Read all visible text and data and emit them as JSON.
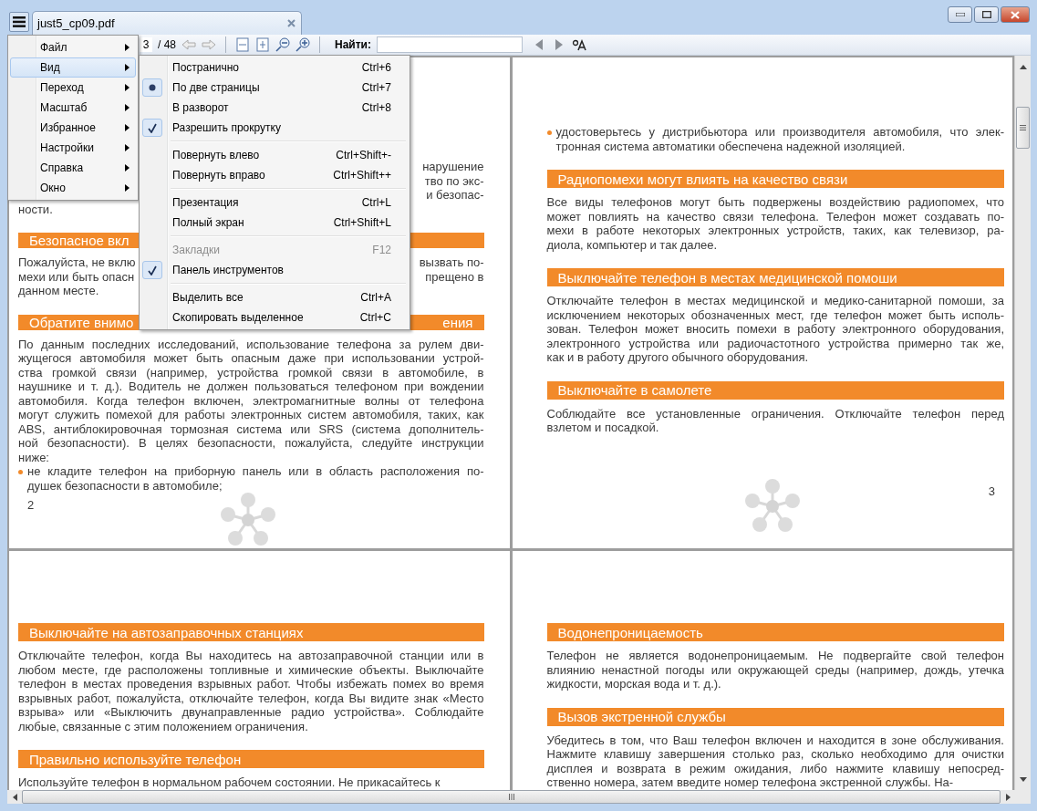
{
  "window": {
    "tab_title": "just5_cp09.pdf"
  },
  "main_menu": [
    {
      "label": "Файл",
      "selected": false
    },
    {
      "label": "Вид",
      "selected": true
    },
    {
      "label": "Переход",
      "selected": false
    },
    {
      "label": "Масштаб",
      "selected": false
    },
    {
      "label": "Избранное",
      "selected": false
    },
    {
      "label": "Настройки",
      "selected": false
    },
    {
      "label": "Справка",
      "selected": false
    },
    {
      "label": "Окно",
      "selected": false
    }
  ],
  "submenu": {
    "groups": [
      [
        {
          "label": "Постранично",
          "shortcut": "Ctrl+6",
          "kind": "radio",
          "checked": false,
          "disabled": false
        },
        {
          "label": "По две страницы",
          "shortcut": "Ctrl+7",
          "kind": "radio",
          "checked": true,
          "disabled": false
        },
        {
          "label": "В разворот",
          "shortcut": "Ctrl+8",
          "kind": "radio",
          "checked": false,
          "disabled": false
        },
        {
          "label": "Разрешить прокрутку",
          "kind": "check",
          "checked": true,
          "disabled": false
        }
      ],
      [
        {
          "label": "Повернуть влево",
          "shortcut": "Ctrl+Shift+-",
          "kind": "check",
          "checked": false,
          "disabled": false
        },
        {
          "label": "Повернуть вправо",
          "shortcut": "Ctrl+Shift++",
          "kind": "check",
          "checked": false,
          "disabled": false
        }
      ],
      [
        {
          "label": "Презентация",
          "shortcut": "Ctrl+L",
          "kind": "check",
          "checked": false,
          "disabled": false
        },
        {
          "label": "Полный экран",
          "shortcut": "Ctrl+Shift+L",
          "kind": "check",
          "checked": false,
          "disabled": false
        }
      ],
      [
        {
          "label": "Закладки",
          "shortcut": "F12",
          "kind": "check",
          "checked": false,
          "disabled": true
        },
        {
          "label": "Панель инструментов",
          "kind": "check",
          "checked": true,
          "disabled": false
        }
      ],
      [
        {
          "label": "Выделить все",
          "shortcut": "Ctrl+A",
          "kind": "check",
          "checked": false,
          "disabled": false
        },
        {
          "label": "Скопировать выделенное",
          "shortcut": "Ctrl+C",
          "kind": "check",
          "checked": false,
          "disabled": false
        }
      ]
    ]
  },
  "toolbar": {
    "page": "3",
    "page_total": "/ 48",
    "find_label": "Найти:"
  },
  "page_rows": [
    [
      {
        "number": "2",
        "blocks": [
          {
            "kind": "fragments",
            "lines": [
              {
                "right": "нарушение"
              },
              {
                "right": "тво по экс-"
              },
              {
                "right": "и безопас-"
              },
              {
                "left": "ности."
              }
            ]
          },
          {
            "kind": "heading_fragments",
            "left": "Безопасное вкл"
          },
          {
            "kind": "fragments",
            "lines": [
              {
                "left": "Пожалуйста, не вклю",
                "right": "вызвать по-"
              },
              {
                "left": "мехи или быть опасн",
                "right": "прещено в"
              },
              {
                "left": "данном месте."
              }
            ]
          },
          {
            "kind": "heading_fragments",
            "left": "Обратите внимо",
            "right": "ения"
          },
          {
            "kind": "paragraph",
            "lines": [
              "По данным последних исследований, использование телефона за рулем дви-",
              "жущегося автомобиля может быть опасным даже при использовании устрой-",
              "ства громкой связи (например, устройства громкой связи в автомобиле, в",
              "наушнике и т. д.). Водитель не должен пользоваться телефоном при вождении",
              "автомобиля. Когда телефон включен, электромагнитные волны от телефона",
              "могут служить помехой для работы электронных систем автомобиля, таких, как",
              "ABS, антиблокировочная тормозная система или SRS (система дополнитель-",
              "ной безопасности). В целях безопасности, пожалуйста, следуйте инструкции",
              "ниже:"
            ]
          },
          {
            "kind": "bullet",
            "lines": [
              "не кладите телефон на приборную панель или в область расположения по-",
              "душек безопасности в автомобиле;"
            ]
          }
        ]
      },
      {
        "number": "3",
        "blocks": [
          {
            "kind": "bullet",
            "lines": [
              "удостоверьтесь у дистрибьютора или производителя автомобиля, что элек-",
              "тронная система автоматики обеспечена надежной изоляцией."
            ]
          },
          {
            "kind": "heading",
            "text": "Радиопомехи могут влиять на качество связи"
          },
          {
            "kind": "paragraph",
            "lines": [
              "Все виды телефонов могут быть подвержены воздействию радиопомех, что",
              "может повлиять на качество связи телефона. Телефон может создавать по-",
              "мехи в работе некоторых электронных устройств, таких, как телевизор, ра-",
              "диола, компьютер и так далее."
            ]
          },
          {
            "kind": "heading",
            "text": "Выключайте телефон в местах медицинской помоши"
          },
          {
            "kind": "paragraph",
            "lines": [
              "Отключайте телефон в местах медицинской и медико-санитарной помоши, за",
              "исключением некоторых обозначенных мест, где телефон может быть исполь-",
              "зован. Телефон может вносить помехи в работу электронного оборудования,",
              "электронного устройства или радиочастотного устройства примерно так же,",
              "как и в работу другого обычного оборудования."
            ]
          },
          {
            "kind": "heading",
            "text": "Выключайте в самолете"
          },
          {
            "kind": "paragraph",
            "lines": [
              "Соблюдайте все установленные ограничения. Отключайте телефон перед",
              "взлетом и посадкой."
            ]
          }
        ]
      }
    ],
    [
      {
        "blocks": [
          {
            "kind": "heading",
            "text": "Выключайте на автозаправочных станциях"
          },
          {
            "kind": "paragraph",
            "lines": [
              "Отключайте телефон, когда Вы находитесь на автозаправочной станции или в",
              "любом месте, где расположены топливные и химические объекты. Выключайте",
              "телефон в местах проведения взрывных работ. Чтобы избежать помех во время",
              "взрывных работ, пожалуйста, отключайте телефон, когда Вы видите знак «Место",
              "взрыва» или «Выключить двунаправленные радио устройства». Соблюдайте",
              "любые, связанные с этим положением ограничения."
            ]
          },
          {
            "kind": "heading",
            "text": "Правильно используйте телефон"
          },
          {
            "kind": "paragraph",
            "lines": [
              "Используйте телефон в нормальном рабочем состоянии. Не прикасайтесь к"
            ]
          }
        ]
      },
      {
        "blocks": [
          {
            "kind": "heading",
            "text": "Водонепроницаемость"
          },
          {
            "kind": "paragraph",
            "lines": [
              "Телефон не является водонепроницаемым. Не подвергайте свой телефон",
              "влиянию ненастной погоды или окружающей среды (например, дождь, утечка",
              "жидкости, морская вода и т. д.)."
            ]
          },
          {
            "kind": "heading",
            "text": "Вызов экстренной службы"
          },
          {
            "kind": "paragraph",
            "lines": [
              "Убедитесь в том, что Ваш телефон включен и находится в зоне обслуживания.",
              "Нажмите клавишу завершения столько раз, сколько необходимо для очистки",
              "дисплея и возврата в режим ожидания, либо нажмите клавишу непосред-",
              "ственно номера, затем введите номер телефона экстренной службы. На-"
            ]
          }
        ]
      }
    ]
  ]
}
